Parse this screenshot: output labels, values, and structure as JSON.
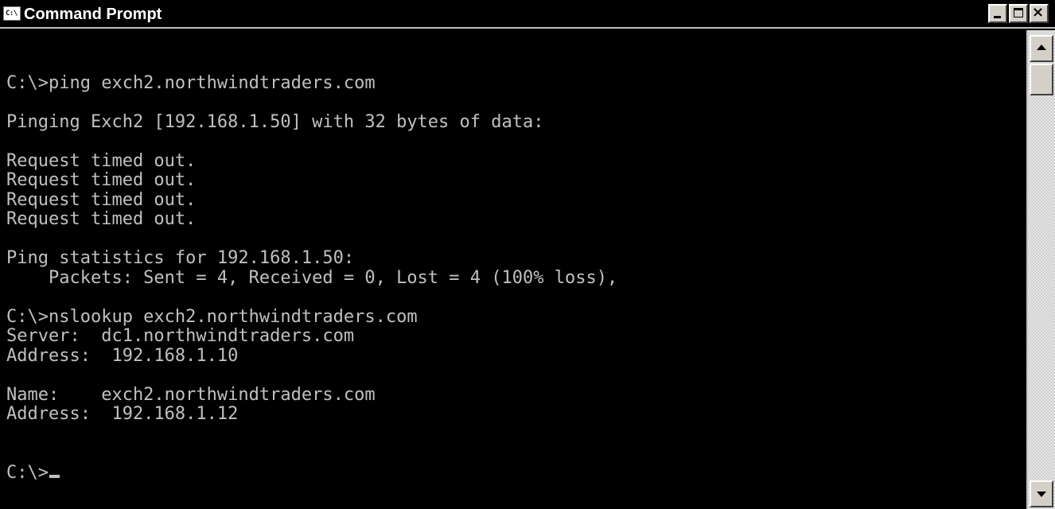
{
  "window": {
    "title": "Command Prompt",
    "icon_text": "C:\\",
    "icon": "console-icon",
    "buttons": {
      "minimize": "minimize-icon",
      "maximize": "maximize-icon",
      "close": "close-icon",
      "close_glyph": "×"
    }
  },
  "console": {
    "lines": [
      "",
      "C:\\>ping exch2.northwindtraders.com",
      "",
      "Pinging Exch2 [192.168.1.50] with 32 bytes of data:",
      "",
      "Request timed out.",
      "Request timed out.",
      "Request timed out.",
      "Request timed out.",
      "",
      "Ping statistics for 192.168.1.50:",
      "    Packets: Sent = 4, Received = 0, Lost = 4 (100% loss),",
      "",
      "C:\\>nslookup exch2.northwindtraders.com",
      "Server:  dc1.northwindtraders.com",
      "Address:  192.168.1.10",
      "",
      "Name:    exch2.northwindtraders.com",
      "Address:  192.168.1.12",
      "",
      "",
      "C:\\>"
    ]
  },
  "scrollbar": {
    "up_icon": "scroll-up-arrow-icon",
    "down_icon": "scroll-down-arrow-icon"
  },
  "colors": {
    "background": "#000000",
    "text": "#c0c0c0",
    "title_text": "#ffffff"
  }
}
